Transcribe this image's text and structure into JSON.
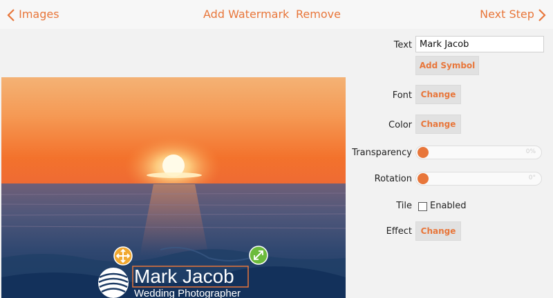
{
  "nav": {
    "back_label": "Images",
    "add_watermark_label": "Add Watermark",
    "remove_label": "Remove",
    "next_label": "Next Step"
  },
  "watermark": {
    "title": "Mark Jacob",
    "subtitle": "Wedding Photographer"
  },
  "panel": {
    "text_label": "Text",
    "text_value": "Mark Jacob",
    "add_symbol_label": "Add Symbol",
    "font_label": "Font",
    "font_button": "Change",
    "color_label": "Color",
    "color_button": "Change",
    "transparency_label": "Transparency",
    "transparency_value": "0%",
    "rotation_label": "Rotation",
    "rotation_value": "0°",
    "tile_label": "Tile",
    "tile_checkbox_label": "Enabled",
    "tile_enabled": false,
    "effect_label": "Effect",
    "effect_button": "Change"
  },
  "colors": {
    "accent": "#e8763a",
    "move_handle": "#f0a830",
    "resize_handle": "#6cbb3c"
  },
  "icons": {
    "back": "chevron-left-icon",
    "next": "chevron-right-icon",
    "move": "move-icon",
    "resize": "resize-icon",
    "logo": "wave-logo"
  }
}
